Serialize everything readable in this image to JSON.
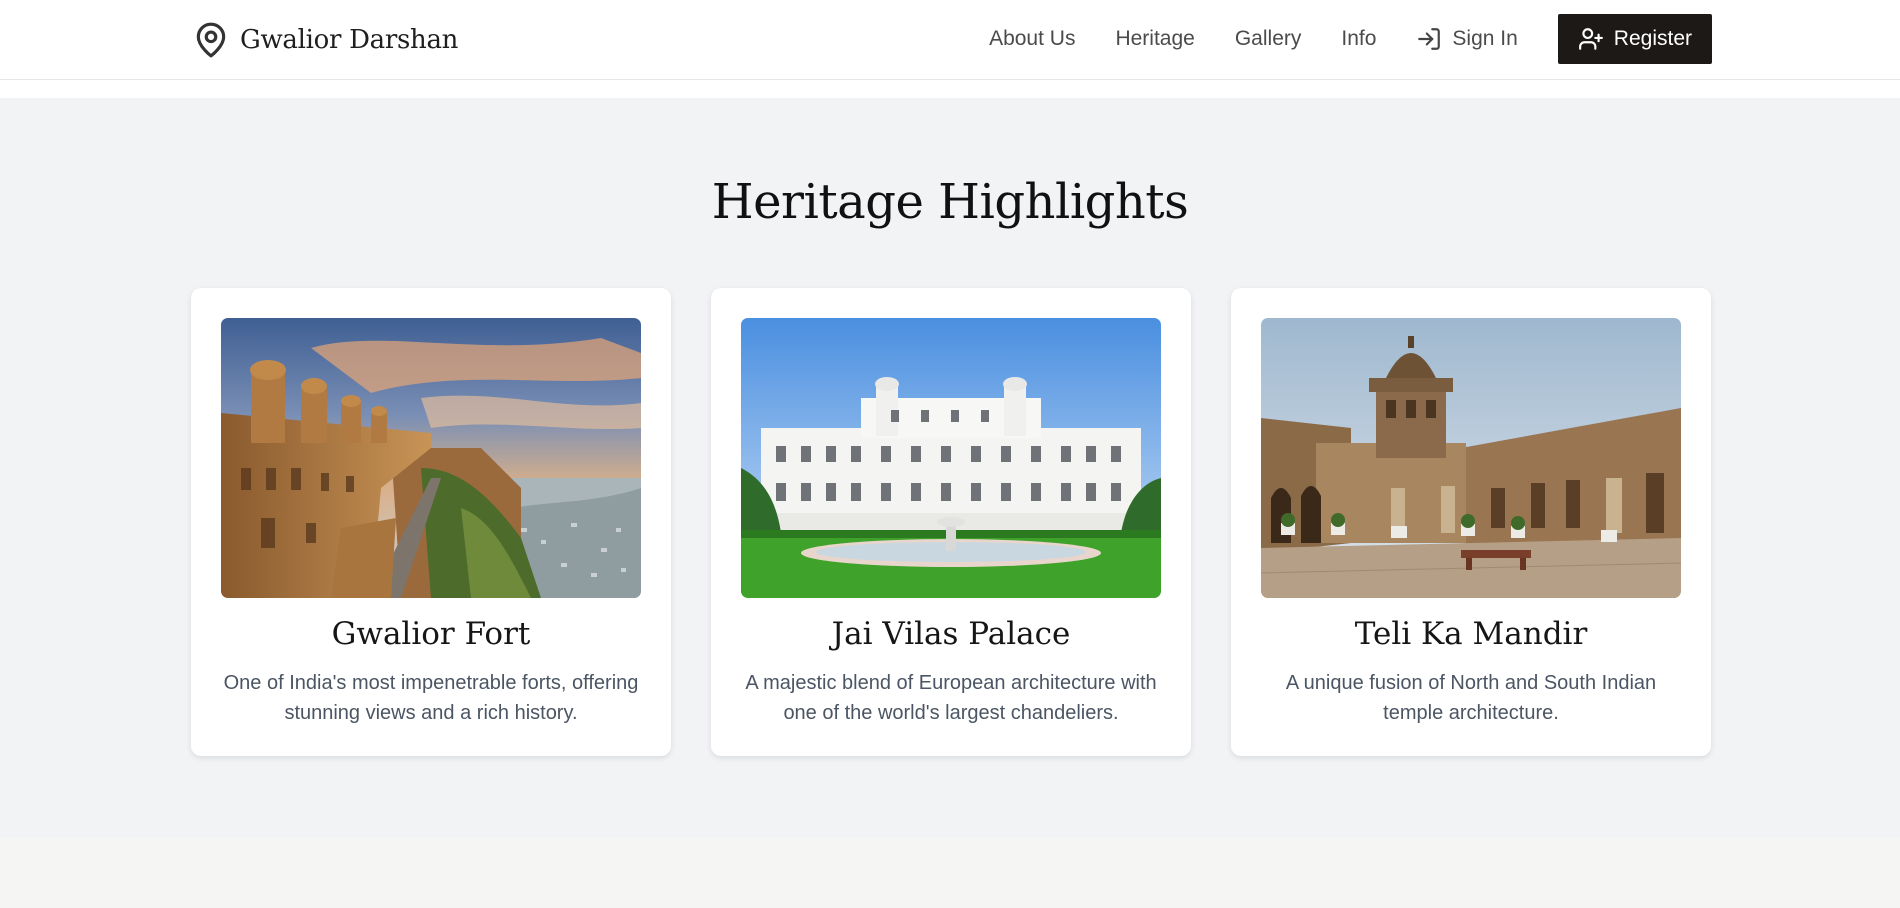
{
  "brand": {
    "name": "Gwalior Darshan",
    "icon": "map-pin-icon"
  },
  "nav": {
    "links": [
      "About Us",
      "Heritage",
      "Gallery",
      "Info"
    ],
    "signin_label": "Sign In",
    "signin_icon": "sign-in-icon",
    "register_label": "Register",
    "register_icon": "user-plus-icon"
  },
  "section": {
    "title": "Heritage Highlights"
  },
  "cards": [
    {
      "title": "Gwalior Fort",
      "description": "One of India's most impenetrable forts, offering stunning views and a rich history.",
      "image": "gwalior-fort-photo"
    },
    {
      "title": "Jai Vilas Palace",
      "description": "A majestic blend of European architecture with one of the world's largest chandeliers.",
      "image": "jai-vilas-palace-photo"
    },
    {
      "title": "Teli Ka Mandir",
      "description": "A unique fusion of North and South Indian temple architecture.",
      "image": "teli-ka-mandir-photo"
    }
  ],
  "colors": {
    "header_bg": "#ffffff",
    "page_bg": "#f2f3f5",
    "register_bg": "#1c1917",
    "text_muted": "#4b5563"
  }
}
